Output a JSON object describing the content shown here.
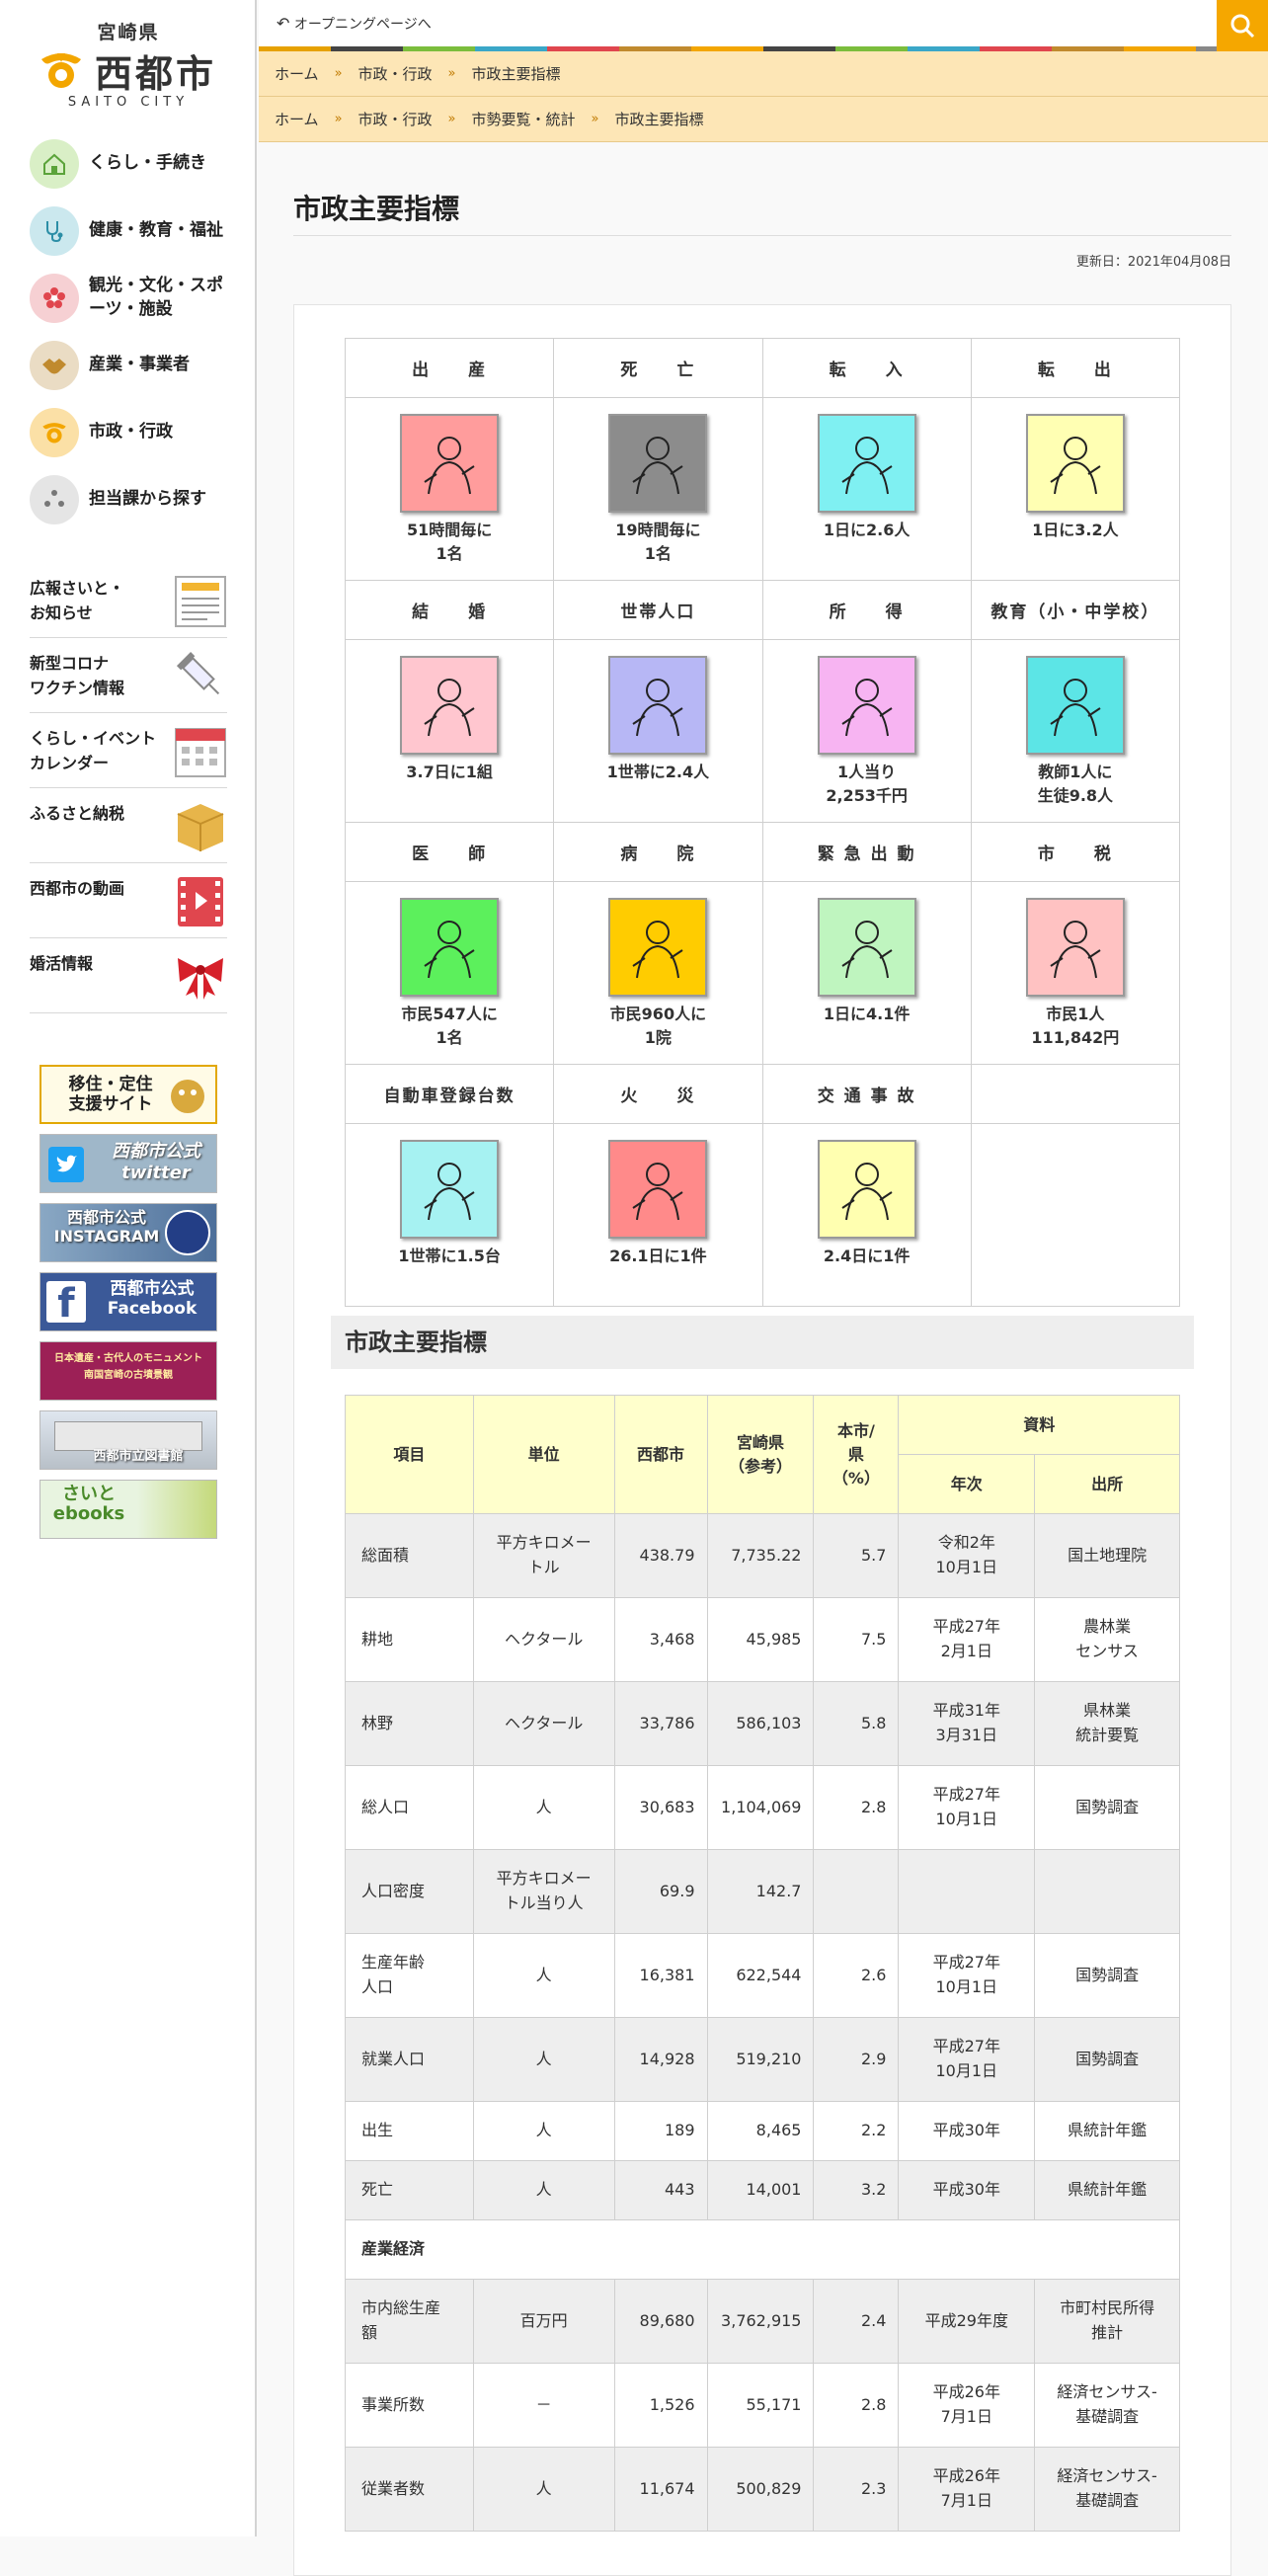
{
  "sidebar": {
    "prefecture": "宮崎県",
    "city": "西都市",
    "city_en": "SAITO CITY",
    "nav": [
      {
        "label": "くらし・手続き",
        "color": "#d9efc6"
      },
      {
        "label": "健康・教育・福祉",
        "color": "#cbe8ee"
      },
      {
        "label": "観光・文化・スポーツ・施設",
        "color": "#f6d0d3"
      },
      {
        "label": "産業・事業者",
        "color": "#eadcc4"
      },
      {
        "label": "市政・行政",
        "color": "#fbe0a6"
      },
      {
        "label": "担当課から探す",
        "color": "#e5e5e5"
      }
    ],
    "links": [
      {
        "label": "広報さいと・\nお知らせ",
        "icon": "newspaper-icon"
      },
      {
        "label": "新型コロナ\nワクチン情報",
        "icon": "syringe-icon"
      },
      {
        "label": "くらし・イベント\nカレンダー",
        "icon": "calendar-icon"
      },
      {
        "label": "ふるさと納税",
        "icon": "box-icon"
      },
      {
        "label": "西都市の動画",
        "icon": "video-icon"
      },
      {
        "label": "婚活情報",
        "icon": "ribbon-icon"
      }
    ],
    "banners": [
      {
        "label": "移住・定住\n支援サイト"
      },
      {
        "label": "西都市公式\ntwitter"
      },
      {
        "label": "西都市公式\nINSTAGRAM"
      },
      {
        "label": "西都市公式\nFacebook"
      },
      {
        "label": "日本遺産・古代人のモニュメント\n南国宮崎の古墳景観"
      },
      {
        "label": "西都市立図書館"
      },
      {
        "label": "さいと\nebooks"
      }
    ]
  },
  "header": {
    "back_label": "オープニングページへ",
    "search_label": "検索"
  },
  "breadcrumb1": [
    "ホーム",
    "市政・行政",
    "市政主要指標"
  ],
  "breadcrumb2": [
    "ホーム",
    "市政・行政",
    "市勢要覧・統計",
    "市政主要指標"
  ],
  "main": {
    "title": "市政主要指標",
    "updated": "更新日：2021年04月08日"
  },
  "indicators": [
    {
      "head": "出　　産",
      "caption": "51時間毎に\n1名",
      "bg": "#ff9c9c",
      "icon": "baby-icon"
    },
    {
      "head": "死　　亡",
      "caption": "19時間毎に\n1名",
      "bg": "#8c8c8c",
      "icon": "death-icon"
    },
    {
      "head": "転　　入",
      "caption": "1日に2.6人",
      "bg": "#7ff0f2",
      "icon": "move-in-icon"
    },
    {
      "head": "転　　出",
      "caption": "1日に3.2人",
      "bg": "#ffffb3",
      "icon": "move-out-icon"
    },
    {
      "head": "結　　婚",
      "caption": "3.7日に1組",
      "bg": "#ffc6cf",
      "icon": "wedding-icon"
    },
    {
      "head": "世帯人口",
      "caption": "1世帯に2.4人",
      "bg": "#b7b7f5",
      "icon": "household-icon"
    },
    {
      "head": "所　　得",
      "caption": "1人当り\n2,253千円",
      "bg": "#f7b4f2",
      "icon": "income-icon"
    },
    {
      "head": "教育（小・中学校）",
      "caption": "教師1人に\n生徒9.8人",
      "bg": "#5ce5e6",
      "icon": "teacher-icon"
    },
    {
      "head": "医　　師",
      "caption": "市民547人に\n1名",
      "bg": "#5cf05c",
      "icon": "doctor-icon"
    },
    {
      "head": "病　　院",
      "caption": "市民960人に\n1院",
      "bg": "#ffcc00",
      "icon": "hospital-icon"
    },
    {
      "head": "緊 急 出 動",
      "caption": "1日に4.1件",
      "bg": "#bff5bf",
      "icon": "ambulance-icon"
    },
    {
      "head": "市　　税",
      "caption": "市民1人\n111,842円",
      "bg": "#ffc2c2",
      "icon": "tax-icon"
    },
    {
      "head": "自動車登録台数",
      "caption": "1世帯に1.5台",
      "bg": "#a6f2f2",
      "icon": "car-icon"
    },
    {
      "head": "火　　災",
      "caption": "26.1日に1件",
      "bg": "#ff8a8a",
      "icon": "fire-icon"
    },
    {
      "head": "交 通 事 故",
      "caption": "2.4日に1件",
      "bg": "#ffffb0",
      "icon": "accident-icon"
    },
    {
      "head": "",
      "caption": "",
      "bg": "",
      "icon": ""
    }
  ],
  "section_title": "市政主要指標",
  "table": {
    "headers": {
      "item": "項目",
      "unit": "単位",
      "city": "西都市",
      "pref": "宮崎県\n（参考）",
      "ratio": "本市/\n県\n（%）",
      "source": "資料",
      "year": "年次",
      "origin": "出所"
    },
    "rows": [
      {
        "item": "総面積",
        "unit": "平方キロメー\nトル",
        "city": "438.79",
        "pref": "7,735.22",
        "ratio": "5.7",
        "year": "令和2年\n10月1日",
        "origin": "国土地理院"
      },
      {
        "item": "耕地",
        "unit": "ヘクタール",
        "city": "3,468",
        "pref": "45,985",
        "ratio": "7.5",
        "year": "平成27年\n2月1日",
        "origin": "農林業\nセンサス"
      },
      {
        "item": "林野",
        "unit": "ヘクタール",
        "city": "33,786",
        "pref": "586,103",
        "ratio": "5.8",
        "year": "平成31年\n3月31日",
        "origin": "県林業\n統計要覧"
      },
      {
        "item": "総人口",
        "unit": "人",
        "city": "30,683",
        "pref": "1,104,069",
        "ratio": "2.8",
        "year": "平成27年\n10月1日",
        "origin": "国勢調査"
      },
      {
        "item": "人口密度",
        "unit": "平方キロメー\nトル当り人",
        "city": "69.9",
        "pref": "142.7",
        "ratio": "",
        "year": "",
        "origin": ""
      },
      {
        "item": "生産年齢\n人口",
        "unit": "人",
        "city": "16,381",
        "pref": "622,544",
        "ratio": "2.6",
        "year": "平成27年\n10月1日",
        "origin": "国勢調査"
      },
      {
        "item": "就業人口",
        "unit": "人",
        "city": "14,928",
        "pref": "519,210",
        "ratio": "2.9",
        "year": "平成27年\n10月1日",
        "origin": "国勢調査"
      },
      {
        "item": "出生",
        "unit": "人",
        "city": "189",
        "pref": "8,465",
        "ratio": "2.2",
        "year": "平成30年",
        "origin": "県統計年鑑"
      },
      {
        "item": "死亡",
        "unit": "人",
        "city": "443",
        "pref": "14,001",
        "ratio": "3.2",
        "year": "平成30年",
        "origin": "県統計年鑑"
      },
      {
        "subhead": "産業経済"
      },
      {
        "item": "市内総生産\n額",
        "unit": "百万円",
        "city": "89,680",
        "pref": "3,762,915",
        "ratio": "2.4",
        "year": "平成29年度",
        "origin": "市町村民所得\n推計"
      },
      {
        "item": "事業所数",
        "unit": "－",
        "city": "1,526",
        "pref": "55,171",
        "ratio": "2.8",
        "year": "平成26年\n7月1日",
        "origin": "経済センサス-\n基礎調査"
      },
      {
        "item": "従業者数",
        "unit": "人",
        "city": "11,674",
        "pref": "500,829",
        "ratio": "2.3",
        "year": "平成26年\n7月1日",
        "origin": "経済センサス-\n基礎調査"
      }
    ]
  }
}
